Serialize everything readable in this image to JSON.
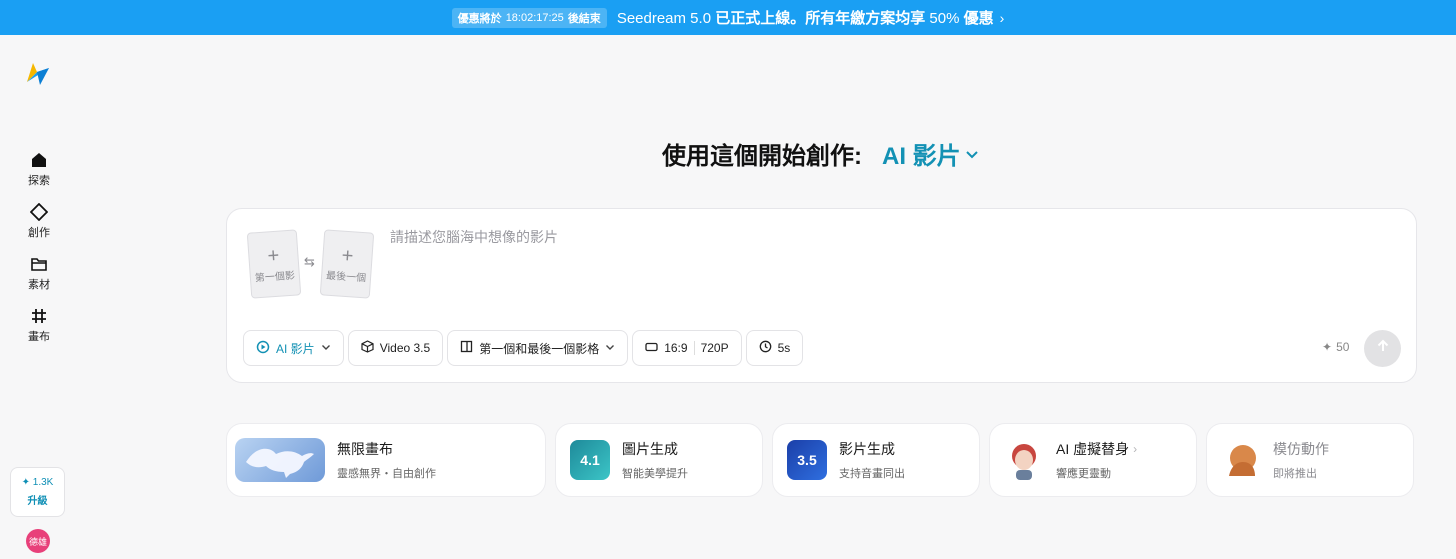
{
  "banner": {
    "timer_prefix": "優惠將於",
    "timer_value": "18:02:17:25",
    "timer_suffix": "後結束",
    "message_brand": "Seedream 5.0",
    "message_text": "已正式上線。所有年繳方案均享",
    "message_pct": "50%",
    "message_end": "優惠",
    "chevron": "›"
  },
  "sidebar": {
    "items": [
      {
        "label": "探索",
        "icon": "home-icon"
      },
      {
        "label": "創作",
        "icon": "diamond-icon"
      },
      {
        "label": "素材",
        "icon": "folder-icon"
      },
      {
        "label": "畫布",
        "icon": "hash-icon"
      }
    ],
    "credits": "✦ 1.3K",
    "upgrade_label": "升級",
    "avatar_text": "德雄"
  },
  "heading": {
    "title": "使用這個開始創作:",
    "mode": "AI 影片"
  },
  "prompt": {
    "first_frame": "第一個影",
    "last_frame": "最後一個",
    "placeholder": "請描述您腦海中想像的影片",
    "options": {
      "mode": "AI 影片",
      "model": "Video 3.5",
      "frames": "第一個和最後一個影格",
      "ratio": "16:9",
      "resolution": "720P",
      "duration": "5s"
    },
    "credits": "50"
  },
  "cards": [
    {
      "title": "無限畫布",
      "sub": "靈感無界・自由創作"
    },
    {
      "title": "圖片生成",
      "sub": "智能美學提升",
      "badge": "4.1"
    },
    {
      "title": "影片生成",
      "sub": "支持音畫同出",
      "badge": "3.5"
    },
    {
      "title": "AI 虛擬替身",
      "sub": "響應更靈動"
    },
    {
      "title": "模仿動作",
      "sub": "即將推出"
    }
  ],
  "colors": {
    "banner": "#1a9ff3",
    "accent": "#1391b4",
    "avatar": "#e8407a"
  }
}
